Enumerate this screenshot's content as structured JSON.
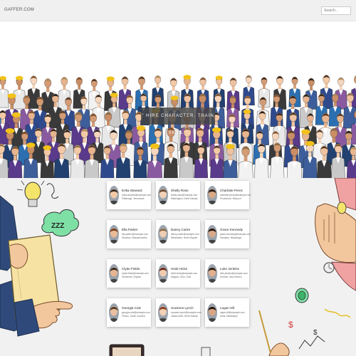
{
  "header": {
    "logo": "GAFFER.COM",
    "search_placeholder": "Search..."
  },
  "hero": {
    "tagline": "\" HIRE CHARACTER. TRAIN SKILL \""
  },
  "people": [
    {
      "name": "Erika Steward",
      "email": "erika.steward@example.com",
      "location": "Pittsburgh, Tennessee",
      "skin": "#f2c9a8",
      "hair": "#3a2a20"
    },
    {
      "name": "Shelly Rose",
      "email": "shelly.rose@example.com",
      "location": "Washington, North Dakota",
      "skin": "#f1d2b8",
      "hair": "#6a4a30"
    },
    {
      "name": "Charlotte Perez",
      "email": "charlotte.perez@example.com",
      "location": "Providence, Missouri",
      "skin": "#d7a985",
      "hair": "#2a1a12"
    },
    {
      "name": "Ella Parker",
      "email": "ella.parker@example.com",
      "location": "Stockton, Massachusetts",
      "skin": "#e9bb96",
      "hair": "#7a3e1e"
    },
    {
      "name": "Danny Carter",
      "email": "danny.carter@example.com",
      "location": "Wiesbaden, North Virginia",
      "skin": "#efcdb2",
      "hair": "#8a6a4a"
    },
    {
      "name": "Grace Kennedy",
      "email": "grace.kennedy@example.com",
      "location": "Hampton, Mississippi",
      "skin": "#d9a888",
      "hair": "#1e1410"
    },
    {
      "name": "Clyde Fields",
      "email": "clyde.fields@example.com",
      "location": "Stoneham, Virginia",
      "skin": "#e6b592",
      "hair": "#3b2a1f"
    },
    {
      "name": "Heidi Hicks",
      "email": "heidi.hicks@example.com",
      "location": "Nagano, Ohio, Ohio",
      "skin": "#f0cbb0",
      "hair": "#6b2a1a"
    },
    {
      "name": "Luke Jenkins",
      "email": "luke.jenkins@example.com",
      "location": "Durham, New Mexico",
      "skin": "#e2b08c",
      "hair": "#2b1d14"
    },
    {
      "name": "Georgia Cole",
      "email": "georgia.cole@example.com",
      "location": "Fresno, South Carolina",
      "skin": "#eac0a0",
      "hair": "#5a3a22"
    },
    {
      "name": "Suzanne Lynch",
      "email": "suzanne.lynch@example.com",
      "location": "Jacksonville, North Dakota",
      "skin": "#f3d1b6",
      "hair": "#8c3b1e"
    },
    {
      "name": "Logan Hill",
      "email": "logan.hill@example.com",
      "location": "Alma, Mississippi",
      "skin": "#d8a683",
      "hair": "#221611"
    }
  ]
}
